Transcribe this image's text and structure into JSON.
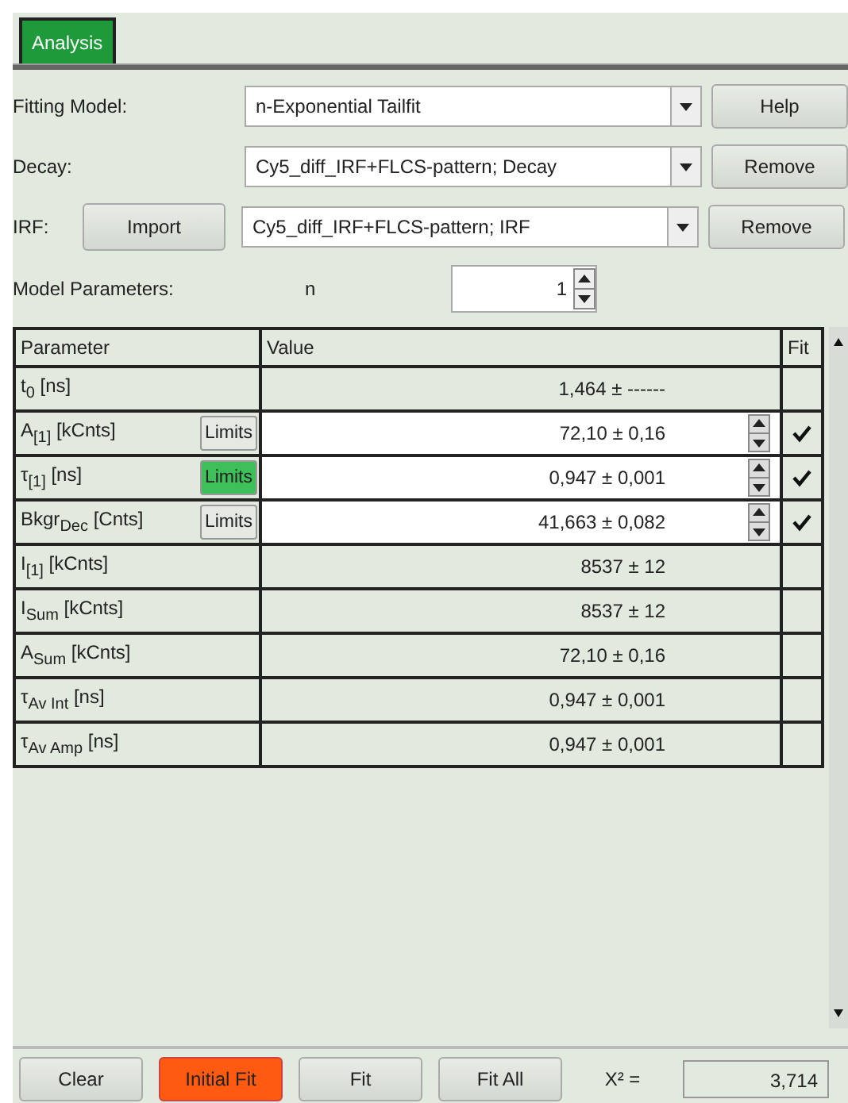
{
  "tabs": [
    {
      "label": "Analysis",
      "selected": true
    }
  ],
  "form": {
    "fitting_model": {
      "label": "Fitting Model:",
      "value": "n-Exponential Tailfit",
      "button": "Help"
    },
    "decay": {
      "label": "Decay:",
      "value": "Cy5_diff_IRF+FLCS-pattern; Decay",
      "button": "Remove"
    },
    "irf": {
      "label": "IRF:",
      "import_button": "Import",
      "value": "Cy5_diff_IRF+FLCS-pattern; IRF",
      "button": "Remove"
    },
    "model_parameters": {
      "label": "Model Parameters:",
      "name": "n",
      "value": "1"
    }
  },
  "table": {
    "columns": [
      "Parameter",
      "Value",
      "Fit"
    ],
    "rows": [
      {
        "kind": "derived",
        "parameter": "t$_{0}$ [ns]",
        "value": "1,464 ± ------"
      },
      {
        "kind": "fit",
        "parameter": "A$_{[1]}$ [kCnts]",
        "limits": {
          "label": "Limits",
          "highlighted": false
        },
        "value": "72,10 ± 0,16",
        "fit": true
      },
      {
        "kind": "fit",
        "parameter": "τ$_{[1]}$ [ns]",
        "limits": {
          "label": "Limits",
          "highlighted": true
        },
        "value": "0,947 ± 0,001",
        "fit": true
      },
      {
        "kind": "fit",
        "parameter": "Bkgr$_{Dec}$ [Cnts]",
        "limits": {
          "label": "Limits",
          "highlighted": false
        },
        "value": "41,663 ± 0,082",
        "fit": true
      },
      {
        "kind": "derived",
        "parameter": "I$_{[1]}$ [kCnts]",
        "value": "8537 ± 12"
      },
      {
        "kind": "derived",
        "parameter": "I$_{Sum}$ [kCnts]",
        "value": "8537 ± 12"
      },
      {
        "kind": "derived",
        "parameter": "A$_{Sum}$ [kCnts]",
        "value": "72,10 ± 0,16"
      },
      {
        "kind": "derived",
        "parameter": "τ$_{Av Int}$ [ns]",
        "value": "0,947 ± 0,001"
      },
      {
        "kind": "derived",
        "parameter": "τ$_{Av Amp}$ [ns]",
        "value": "0,947 ± 0,001"
      }
    ]
  },
  "footer": {
    "buttons": [
      {
        "label": "Clear",
        "highlighted": false
      },
      {
        "label": "Initial Fit",
        "highlighted": true
      },
      {
        "label": "Fit",
        "highlighted": false
      },
      {
        "label": "Fit All",
        "highlighted": false
      }
    ],
    "chi_label": "X² =",
    "chi_value": "3,714"
  }
}
